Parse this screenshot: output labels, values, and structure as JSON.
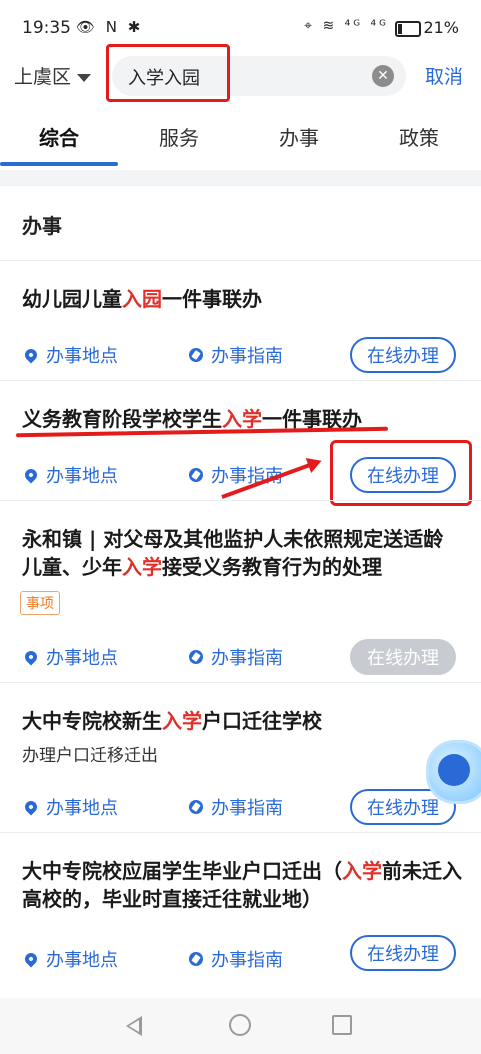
{
  "status": {
    "time": "19:35",
    "left_icons": "👁 N ✱",
    "right_icons": "⌖ ≋ ⁴ᴳ ⁴ᴳ",
    "battery": "21%"
  },
  "search": {
    "district": "上虞区",
    "query": "入学入园",
    "cancel": "取消"
  },
  "tabs": [
    "综合",
    "服务",
    "办事",
    "政策"
  ],
  "section_title": "办事",
  "labels": {
    "place": "办事地点",
    "guide": "办事指南",
    "online": "在线办理"
  },
  "items": [
    {
      "title_pre": "幼儿园儿童",
      "title_hl": "入园",
      "title_post": "一件事联办"
    },
    {
      "title_pre": "义务教育阶段学校学生",
      "title_hl": "入学",
      "title_post": "一件事联办"
    },
    {
      "title_pre": "永和镇 | 对父母及其他监护人未依照规定送适龄儿童、少年",
      "title_hl": "入学",
      "title_post": "接受义务教育行为的处理",
      "tag": "事项"
    },
    {
      "title_pre": "大中专院校新生",
      "title_hl": "入学",
      "title_post": "户口迁往学校",
      "subtitle": "办理户口迁移迁出"
    },
    {
      "title_pre": "大中专院校应届学生毕业户口迁出（",
      "title_hl": "入学",
      "title_post": "前未迁入高校的，毕业时直接迁往就业地）"
    }
  ]
}
